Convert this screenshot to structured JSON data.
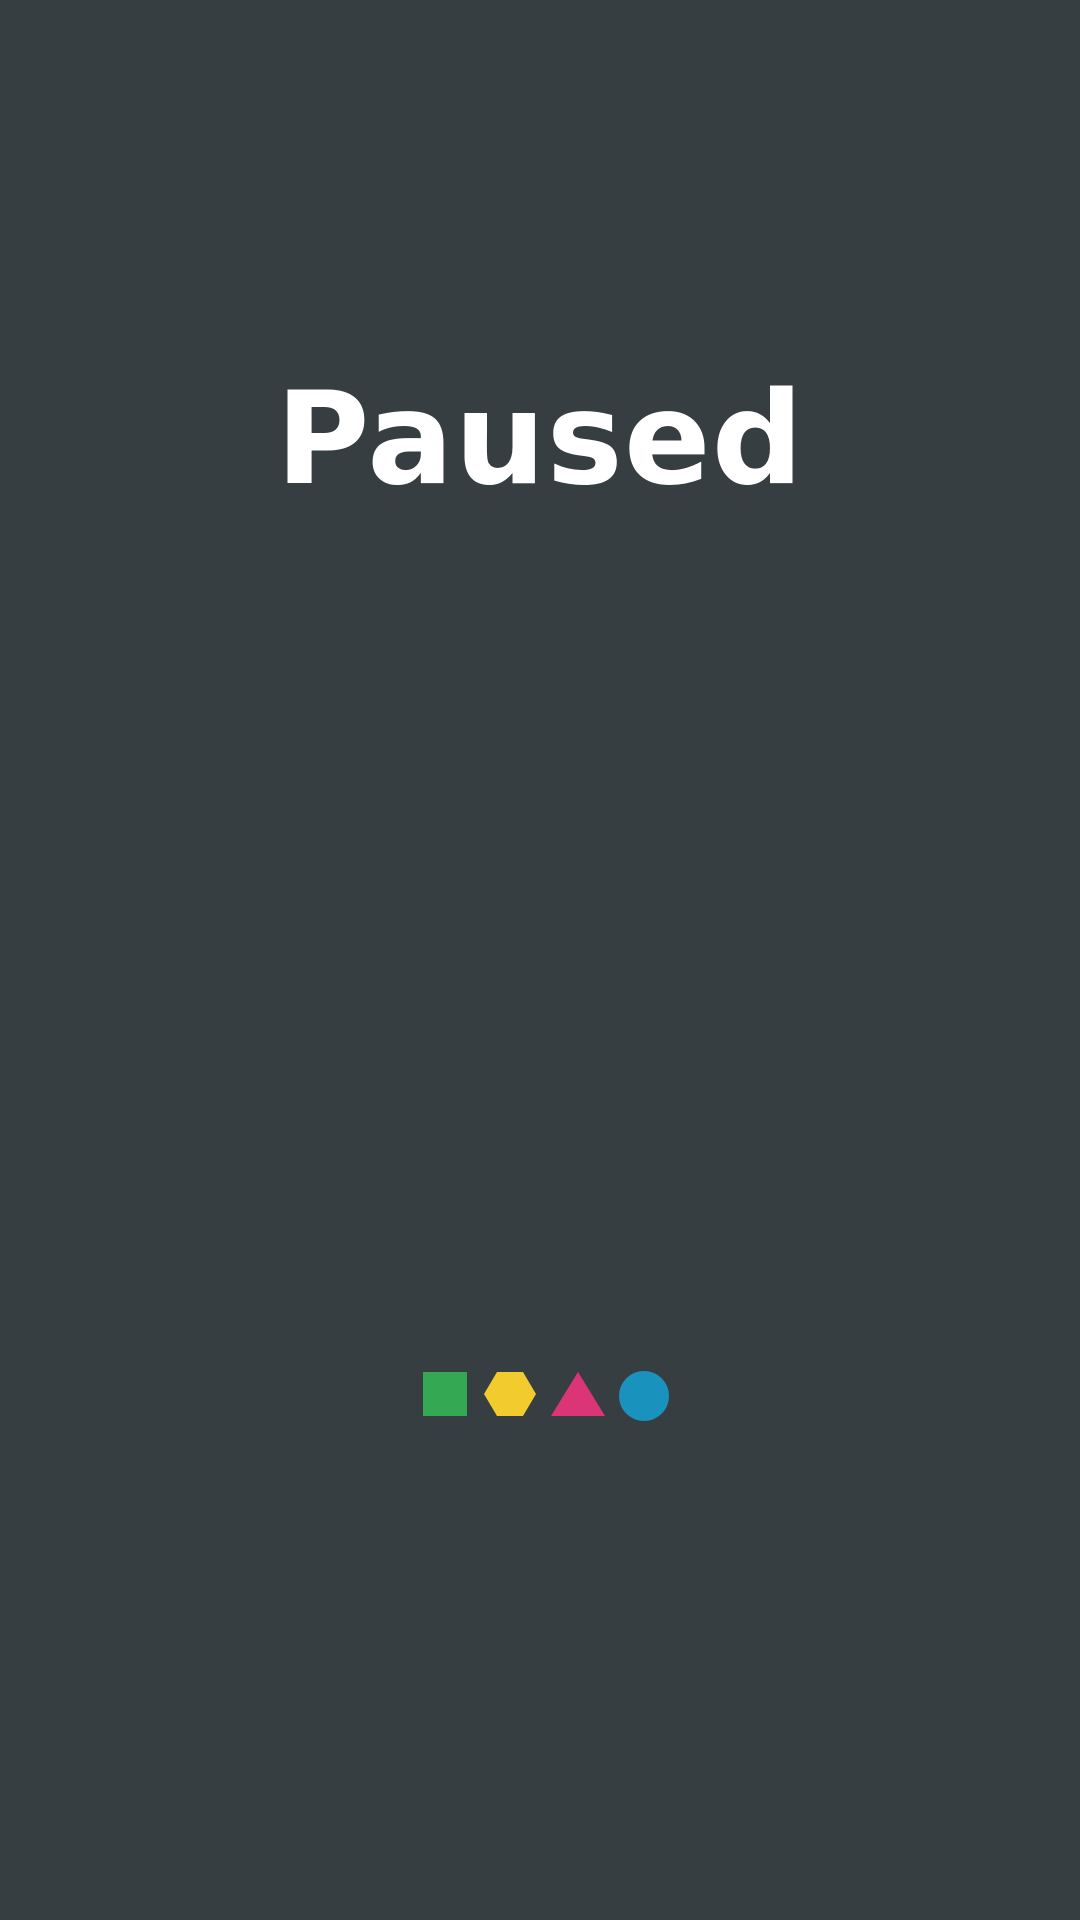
{
  "screen": {
    "title": "Paused"
  },
  "shapes": [
    {
      "name": "green-square-icon",
      "color": "#35a853"
    },
    {
      "name": "yellow-hexagon-icon",
      "color": "#f2cb2f"
    },
    {
      "name": "pink-triangle-icon",
      "color": "#db3577"
    },
    {
      "name": "blue-circle-icon",
      "color": "#1992bd"
    }
  ],
  "colors": {
    "background": "#373e41",
    "text": "#ffffff"
  }
}
